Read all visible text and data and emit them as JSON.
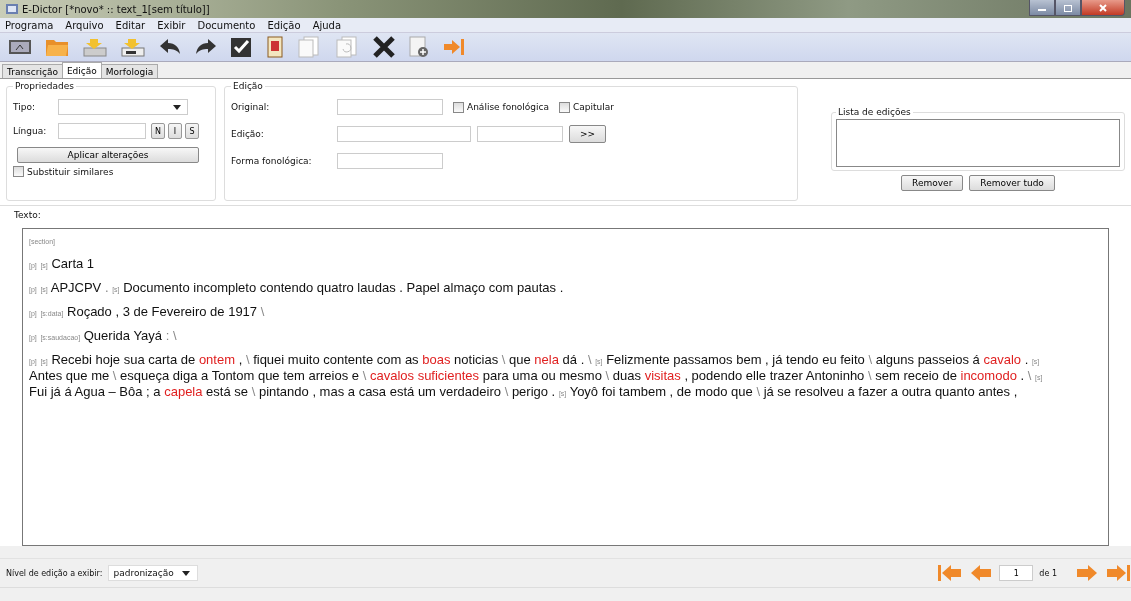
{
  "window": {
    "title": "E-Dictor [*novo* :: text_1[sem título]]"
  },
  "menu": [
    "Programa",
    "Arquivo",
    "Editar",
    "Exibir",
    "Documento",
    "Edição",
    "Ajuda"
  ],
  "tabs": [
    {
      "label": "Transcrição",
      "selected": false
    },
    {
      "label": "Edição",
      "selected": true
    },
    {
      "label": "Morfologia",
      "selected": false
    }
  ],
  "properties": {
    "title": "Propriedades",
    "type_label": "Tipo:",
    "language_label": "Língua:",
    "style_buttons": [
      "N",
      "I",
      "S"
    ],
    "apply_button": "Aplicar alterações",
    "similar_checkbox": {
      "label": "Substituir similares",
      "checked": false
    }
  },
  "edition": {
    "title": "Edição",
    "original_label": "Original:",
    "checkboxes": [
      {
        "label": "Análise fonológica",
        "checked": false
      },
      {
        "label": "Capitular",
        "checked": false
      }
    ],
    "edition_label": "Edição:",
    "arrow_button": ">>",
    "phonological_label": "Forma fonológica:"
  },
  "edit_list": {
    "title": "Lista de edições",
    "buttons": [
      "Remover",
      "Remover tudo"
    ]
  },
  "text_panel": {
    "label": "Texto:",
    "paragraphs": [
      [
        {
          "kind": "tag",
          "text": "[section]"
        }
      ],
      [
        {
          "kind": "tag",
          "text": "[p]"
        },
        {
          "kind": "tag",
          "text": "[s]"
        },
        {
          "kind": "text",
          "text": "Carta 1"
        }
      ],
      [
        {
          "kind": "tag",
          "text": "[p]"
        },
        {
          "kind": "tag",
          "text": "[s]"
        },
        {
          "kind": "text",
          "text": "APJCPV"
        },
        {
          "kind": "mark",
          "text": "."
        },
        {
          "kind": "tag",
          "text": "[s]"
        },
        {
          "kind": "text",
          "text": "Documento incompleto contendo quatro laudas . Papel almaço com pautas ."
        }
      ],
      [
        {
          "kind": "tag",
          "text": "[p]"
        },
        {
          "kind": "tag",
          "text": "[s:data]"
        },
        {
          "kind": "text",
          "text": "Roçado , 3 de Fevereiro de 1917"
        },
        {
          "kind": "mark",
          "text": "\\"
        }
      ],
      [
        {
          "kind": "tag",
          "text": "[p]"
        },
        {
          "kind": "tag",
          "text": "[s:saudacao]"
        },
        {
          "kind": "text",
          "text": "Querida Yayá"
        },
        {
          "kind": "mark",
          "text": ":"
        },
        {
          "kind": "mark",
          "text": "\\"
        }
      ],
      [
        {
          "kind": "tag",
          "text": "[p]"
        },
        {
          "kind": "tag",
          "text": "[s]"
        },
        {
          "kind": "text",
          "text": "Recebi hoje sua carta de"
        },
        {
          "kind": "edited",
          "text": "ontem"
        },
        {
          "kind": "text",
          "text": ","
        },
        {
          "kind": "mark",
          "text": "\\"
        },
        {
          "kind": "text",
          "text": "fiquei muito contente com as"
        },
        {
          "kind": "edited",
          "text": "boas"
        },
        {
          "kind": "text",
          "text": "noticias"
        },
        {
          "kind": "mark",
          "text": "\\"
        },
        {
          "kind": "text",
          "text": "que"
        },
        {
          "kind": "edited",
          "text": "nela"
        },
        {
          "kind": "text",
          "text": "dá ."
        },
        {
          "kind": "mark",
          "text": "\\"
        },
        {
          "kind": "tag",
          "text": "[s]"
        },
        {
          "kind": "text",
          "text": "Felizmente passamos bem , já tendo eu feito"
        },
        {
          "kind": "mark",
          "text": "\\"
        },
        {
          "kind": "text",
          "text": "alguns passeios á"
        },
        {
          "kind": "edited",
          "text": "cavalo"
        },
        {
          "kind": "text",
          "text": "."
        },
        {
          "kind": "tag",
          "text": "[s]"
        },
        {
          "kind": "text",
          "text": "Antes que me"
        },
        {
          "kind": "mark",
          "text": "\\"
        },
        {
          "kind": "text",
          "text": "esqueça diga a Tontom que tem arreios e"
        },
        {
          "kind": "mark",
          "text": "\\"
        },
        {
          "kind": "edited",
          "text": "cavalos suficientes"
        },
        {
          "kind": "text",
          "text": "para uma ou mesmo"
        },
        {
          "kind": "mark",
          "text": "\\"
        },
        {
          "kind": "text",
          "text": "duas"
        },
        {
          "kind": "edited",
          "text": "visitas"
        },
        {
          "kind": "text",
          "text": ", podendo elle trazer Antoninho"
        },
        {
          "kind": "mark",
          "text": "\\"
        },
        {
          "kind": "text",
          "text": "sem receio de"
        },
        {
          "kind": "edited",
          "text": "incomodo"
        },
        {
          "kind": "text",
          "text": "."
        },
        {
          "kind": "mark",
          "text": "\\"
        },
        {
          "kind": "tag",
          "text": "[s]"
        },
        {
          "kind": "text",
          "text": "Fui já á Agua – Bôa ; a"
        },
        {
          "kind": "edited",
          "text": "capela"
        },
        {
          "kind": "text",
          "text": "está se"
        },
        {
          "kind": "mark",
          "text": "\\"
        },
        {
          "kind": "text",
          "text": "pintando , mas a casa está um verdadeiro"
        },
        {
          "kind": "mark",
          "text": "\\"
        },
        {
          "kind": "text",
          "text": "perigo ."
        },
        {
          "kind": "tag",
          "text": "[s]"
        },
        {
          "kind": "text",
          "text": "Yoyô foi tambem , de modo que"
        },
        {
          "kind": "mark",
          "text": "\\"
        },
        {
          "kind": "text",
          "text": "já se resolveu a fazer a outra quanto antes ,"
        }
      ]
    ]
  },
  "footer": {
    "level_label": "Nível de edição a exibir:",
    "level_value": "padronização",
    "page": "1",
    "page_total": "de 1"
  }
}
